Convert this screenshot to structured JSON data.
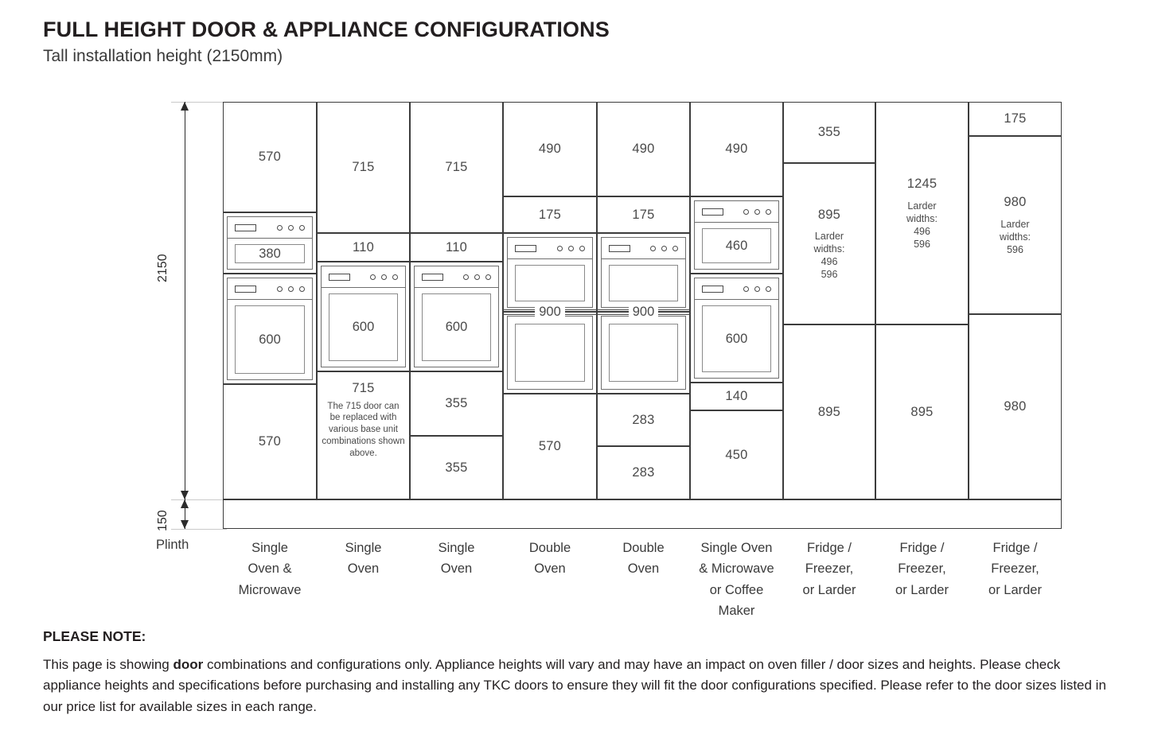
{
  "header": {
    "title": "FULL HEIGHT DOOR & APPLIANCE CONFIGURATIONS",
    "subtitle": "Tall installation height (2150mm)"
  },
  "dimensions": {
    "total_height": "2150",
    "plinth_height": "150",
    "plinth_label": "Plinth"
  },
  "columns": [
    {
      "id": "single-oven-microwave",
      "label": "Single\nOven &\nMicrowave",
      "cells": [
        {
          "type": "door",
          "value": "570"
        },
        {
          "type": "appliance",
          "value": "380",
          "kind": "microwave"
        },
        {
          "type": "appliance",
          "value": "600",
          "kind": "oven"
        },
        {
          "type": "door",
          "value": "570"
        }
      ]
    },
    {
      "id": "single-oven-2",
      "label": "Single\nOven",
      "cells": [
        {
          "type": "door",
          "value": "715"
        },
        {
          "type": "door",
          "value": "110"
        },
        {
          "type": "appliance",
          "value": "600",
          "kind": "oven"
        },
        {
          "type": "door",
          "value": "715",
          "note": "The 715 door can be replaced with various base unit combinations shown above."
        }
      ]
    },
    {
      "id": "single-oven-3",
      "label": "Single\nOven",
      "cells": [
        {
          "type": "door",
          "value": "715"
        },
        {
          "type": "door",
          "value": "110"
        },
        {
          "type": "appliance",
          "value": "600",
          "kind": "oven"
        },
        {
          "type": "door",
          "value": "355"
        },
        {
          "type": "door",
          "value": "355"
        }
      ]
    },
    {
      "id": "double-oven-4",
      "label": "Double\nOven",
      "cells": [
        {
          "type": "door",
          "value": "490"
        },
        {
          "type": "door",
          "value": "175"
        },
        {
          "type": "double-appliance",
          "value": "900"
        },
        {
          "type": "door",
          "value": "570"
        }
      ]
    },
    {
      "id": "double-oven-5",
      "label": "Double\nOven",
      "cells": [
        {
          "type": "door",
          "value": "490"
        },
        {
          "type": "door",
          "value": "175"
        },
        {
          "type": "double-appliance",
          "value": "900"
        },
        {
          "type": "door",
          "value": "283"
        },
        {
          "type": "door",
          "value": "283"
        }
      ]
    },
    {
      "id": "single-oven-microwave-coffee",
      "label": "Single Oven\n& Microwave\nor Coffee\nMaker",
      "cells": [
        {
          "type": "door",
          "value": "490"
        },
        {
          "type": "appliance",
          "value": "460",
          "kind": "microwave"
        },
        {
          "type": "appliance",
          "value": "600",
          "kind": "oven"
        },
        {
          "type": "door",
          "value": "140"
        },
        {
          "type": "door",
          "value": "450"
        }
      ]
    },
    {
      "id": "fridge-freezer-larder-7",
      "label": "Fridge /\nFreezer,\nor Larder",
      "cells": [
        {
          "type": "door",
          "value": "355"
        },
        {
          "type": "door",
          "value": "895",
          "sub": "Larder\nwidths:\n496\n596"
        },
        {
          "type": "door",
          "value": "895"
        }
      ]
    },
    {
      "id": "fridge-freezer-larder-8",
      "label": "Fridge /\nFreezer,\nor Larder",
      "cells": [
        {
          "type": "door",
          "value": "1245",
          "sub": "Larder\nwidths:\n496\n596"
        },
        {
          "type": "door",
          "value": "895"
        }
      ]
    },
    {
      "id": "fridge-freezer-larder-9",
      "label": "Fridge /\nFreezer,\nor Larder",
      "cells": [
        {
          "type": "door",
          "value": "175"
        },
        {
          "type": "door",
          "value": "980",
          "sub": "Larder\nwidths:\n596"
        },
        {
          "type": "door",
          "value": "980"
        }
      ]
    }
  ],
  "note": {
    "heading": "PLEASE NOTE:",
    "body_part1": "This page is showing ",
    "body_bold": "door",
    "body_part2": " combinations and configurations only. Appliance heights will vary and may have an impact on oven filler / door sizes and heights. Please check appliance heights and specifications before purchasing and installing any TKC doors to ensure they will fit the door configurations specified. Please refer to the door sizes listed in our price list for available sizes in each range."
  }
}
